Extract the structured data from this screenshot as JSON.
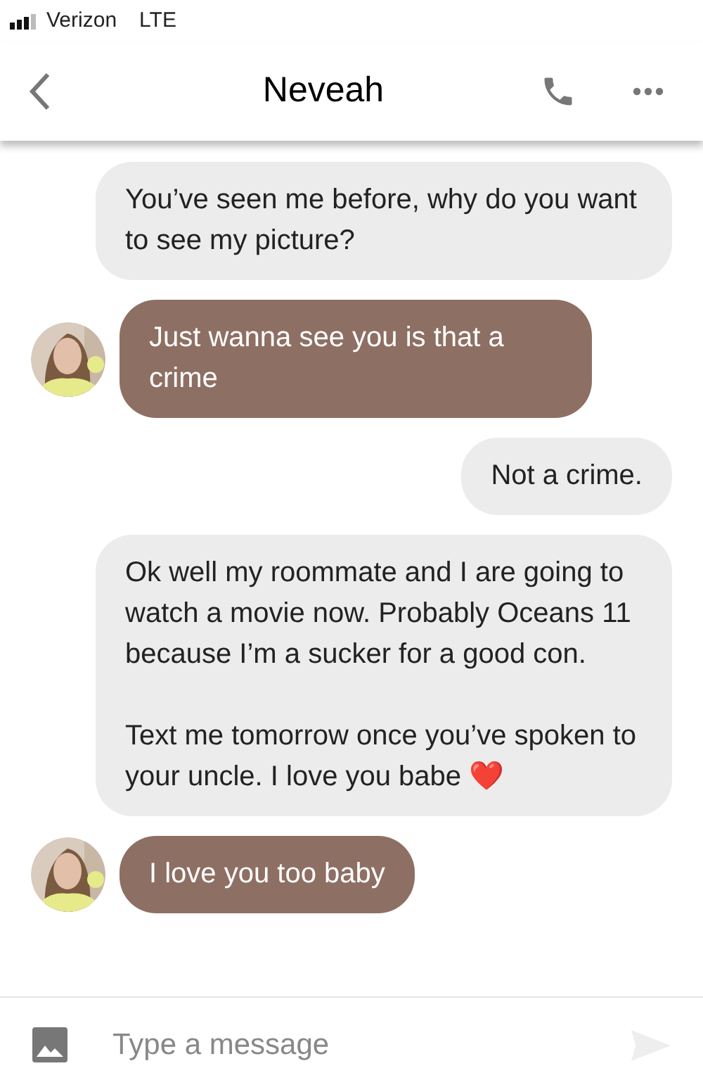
{
  "status_bar": {
    "carrier": "Verizon",
    "network": "LTE"
  },
  "header": {
    "title": "Neveah"
  },
  "messages": [
    {
      "kind": "sent",
      "paragraphs": [
        "You’ve seen me before, why do you want to see my picture?"
      ]
    },
    {
      "kind": "received",
      "paragraphs": [
        "Just wanna see you is that a crime"
      ]
    },
    {
      "kind": "sent",
      "paragraphs": [
        "Not a crime."
      ]
    },
    {
      "kind": "sent",
      "paragraphs": [
        "Ok well my roommate and I are going to watch a movie now. Probably Oceans 11 because I’m a sucker for a good con.",
        "Text me tomorrow once you’ve spoken to your uncle. I love you babe ❤️"
      ]
    },
    {
      "kind": "received",
      "paragraphs": [
        "I love you too baby"
      ]
    }
  ],
  "composer": {
    "placeholder": "Type a message"
  }
}
